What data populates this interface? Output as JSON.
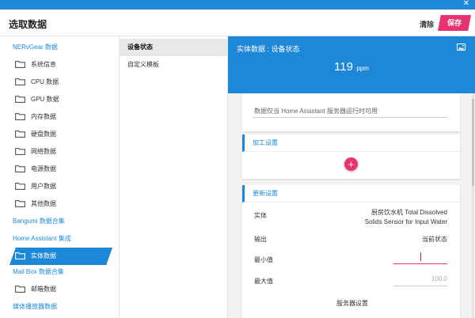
{
  "window": {
    "close_glyph": "✕"
  },
  "header": {
    "title": "选取数据",
    "clear_label": "清除",
    "save_label": "保存"
  },
  "sidebar": {
    "groups": [
      {
        "label": "NERvGear 数据"
      },
      {
        "label": "Bangumi 数据合集"
      },
      {
        "label": "Home Assistant 集成"
      },
      {
        "label": "Mail Box 数据合集"
      },
      {
        "label": "媒体播放器数据"
      }
    ],
    "items": [
      {
        "label": "系统信息"
      },
      {
        "label": "CPU 数据"
      },
      {
        "label": "GPU 数据"
      },
      {
        "label": "内存数据"
      },
      {
        "label": "硬盘数据"
      },
      {
        "label": "网络数据"
      },
      {
        "label": "电源数据"
      },
      {
        "label": "用户数据"
      },
      {
        "label": "其他数据"
      },
      {
        "label": "实体数据",
        "active": true
      },
      {
        "label": "邮箱数据"
      }
    ]
  },
  "tabs": [
    {
      "label": "设备状态",
      "active": true
    },
    {
      "label": "自定义模板"
    }
  ],
  "preview": {
    "title": "实体数据 : 设备状态",
    "value": "119",
    "unit": "ppm",
    "icon": "image-icon"
  },
  "main": {
    "note": "数据仅当 Home Assistant 服务器运行时可用",
    "processing": {
      "title": "加工设置",
      "add_glyph": "+"
    },
    "update": {
      "title": "更新设置",
      "entity_label": "实体",
      "entity_value_line1": "厨房饮水机 Total Dissolved",
      "entity_value_line2": "Solids Sensor for Input Water",
      "output_label": "输出",
      "output_value": "当前状态",
      "min_label": "最小值",
      "min_value": "",
      "max_label": "最大值",
      "max_placeholder": "100.0",
      "server_settings": "服务器设置"
    }
  },
  "colors": {
    "accent": "#1e88d8",
    "pink": "#e8336e",
    "folder": "#555555"
  }
}
